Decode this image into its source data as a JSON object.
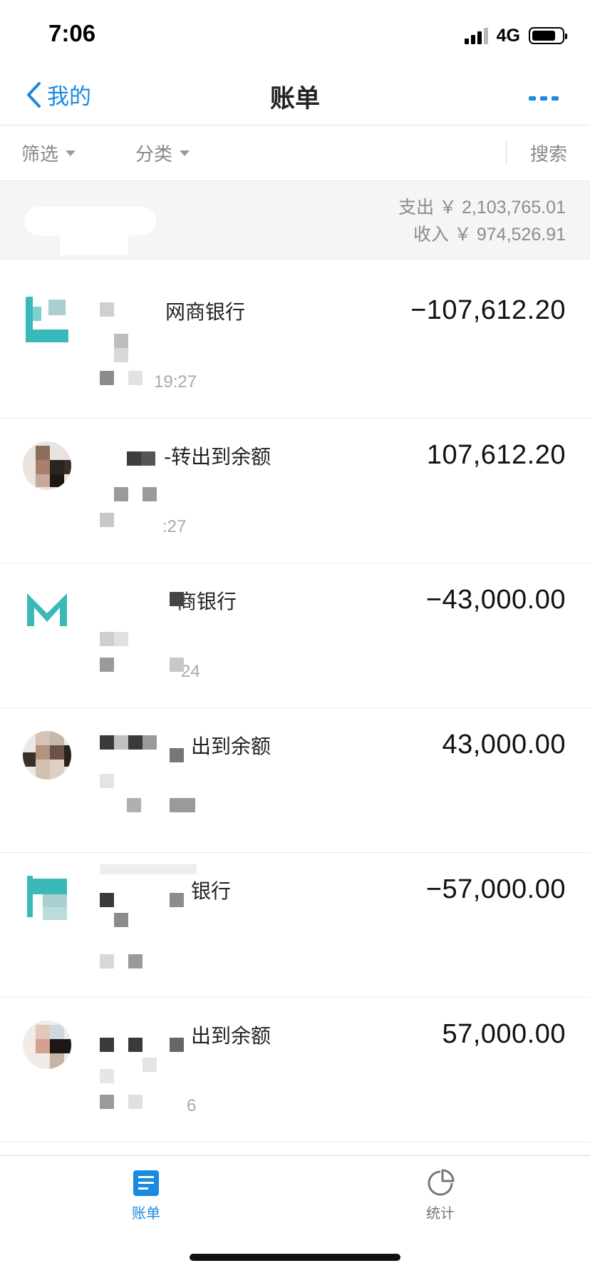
{
  "status_bar": {
    "time": "7:06",
    "network": "4G"
  },
  "nav": {
    "back_label": "我的",
    "title": "账单"
  },
  "filters": {
    "screen_label": "筛选",
    "category_label": "分类",
    "search_label": "搜索"
  },
  "summary": {
    "expense": "支出 ￥ 2,103,765.01",
    "income": "收入 ￥ 974,526.91"
  },
  "bills": [
    {
      "title": "网商银行",
      "time": "19:27",
      "amount": "−107,612.20",
      "avatar": "bank-logo"
    },
    {
      "title": "-转出到余额",
      "time": ":27",
      "amount": "107,612.20",
      "avatar": "person-photo"
    },
    {
      "title": "商银行",
      "time": "24",
      "amount": "−43,000.00",
      "avatar": "bank-logo"
    },
    {
      "title": "出到余额",
      "time": "",
      "amount": "43,000.00",
      "avatar": "person-photo"
    },
    {
      "title": "银行",
      "time": "",
      "amount": "−57,000.00",
      "avatar": "bank-logo"
    },
    {
      "title": "出到余额",
      "time": "6",
      "amount": "57,000.00",
      "avatar": "person-photo"
    }
  ],
  "tabs": {
    "bills_label": "账单",
    "stats_label": "统计"
  },
  "colors": {
    "accent": "#1a8ae0",
    "bank_teal": "#3bb8b8",
    "summary_bg": "#f5f5f5"
  }
}
